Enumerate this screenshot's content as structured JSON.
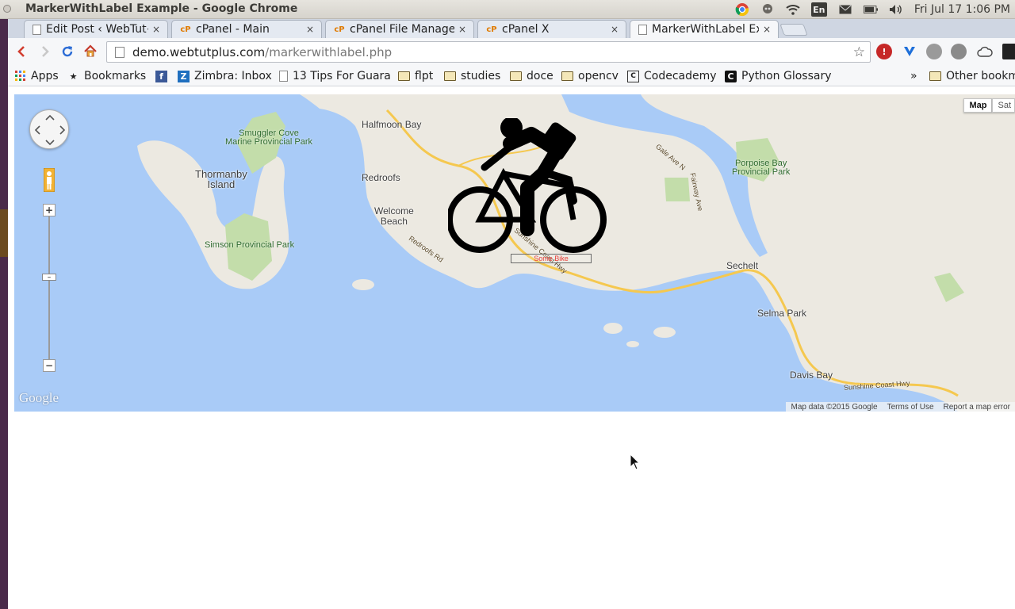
{
  "os_panel": {
    "window_title": "MarkerWithLabel Example - Google Chrome",
    "input_method": "En",
    "clock": "Fri Jul 17  1:06 PM"
  },
  "tabs": [
    {
      "label": "Edit Post ‹ WebTut+",
      "favicon": "page-icon",
      "active": false
    },
    {
      "label": "cPanel - Main",
      "favicon": "cpanel-icon",
      "active": false
    },
    {
      "label": "cPanel File Manager",
      "favicon": "cpanel-icon",
      "active": false
    },
    {
      "label": "cPanel X",
      "favicon": "cpanel-icon",
      "active": false
    },
    {
      "label": "MarkerWithLabel Ex",
      "favicon": "page-icon",
      "active": true
    }
  ],
  "tab_close_glyph": "×",
  "address_bar": {
    "host": "demo.webtutplus.com",
    "path": "/markerwithlabel.php"
  },
  "bookmarks": [
    {
      "label": "Apps",
      "icon": "apps-grid-icon"
    },
    {
      "label": "Bookmarks",
      "icon": "star-icon"
    },
    {
      "label": "",
      "icon": "facebook-icon"
    },
    {
      "label": "Zimbra: Inbox",
      "icon": "zimbra-icon"
    },
    {
      "label": "13 Tips For Guara",
      "icon": "page-icon"
    },
    {
      "label": "flpt",
      "icon": "folder-icon"
    },
    {
      "label": "studies",
      "icon": "folder-icon"
    },
    {
      "label": "doce",
      "icon": "folder-icon"
    },
    {
      "label": "opencv",
      "icon": "folder-icon"
    },
    {
      "label": "Codecademy",
      "icon": "codecademy-icon"
    },
    {
      "label": "Python Glossary",
      "icon": "python-glossary-icon"
    }
  ],
  "bookmarks_overflow": "»",
  "other_bookmarks": "Other bookm",
  "map": {
    "type_buttons": {
      "map": "Map",
      "satellite": "Sat"
    },
    "places": {
      "halfmoon_bay": "Halfmoon Bay",
      "redroofs": "Redroofs",
      "welcome_beach": "Welcome\nBeach",
      "thormanby": "Thormanby\nIsland",
      "sechelt": "Sechelt",
      "selma_park": "Selma Park",
      "davis_bay": "Davis Bay"
    },
    "parks": {
      "smuggler_cove": "Smuggler Cove\nMarine Provincial Park",
      "simson": "Simson Provincial Park",
      "porpoise_bay": "Porpoise Bay\nProvincial Park"
    },
    "roads": {
      "redroofs_rd": "Redroofs Rd",
      "sunshine_coast_hwy_1": "Sunshine Coast Hwy",
      "sunshine_coast_hwy_2": "Sunshine Coast Hwy",
      "gale_ave": "Gale Ave N",
      "fairway_ave": "Fairway Ave"
    },
    "marker_label": "Some Bike",
    "google_logo": "Google",
    "attribution": {
      "map_data": "Map data ©2015 Google",
      "terms": "Terms of Use",
      "report": "Report a map error"
    },
    "colors": {
      "water": "#a9cbf7",
      "land": "#ece9e1",
      "park": "#c3ddaa",
      "highway": "#f5c84f"
    }
  }
}
